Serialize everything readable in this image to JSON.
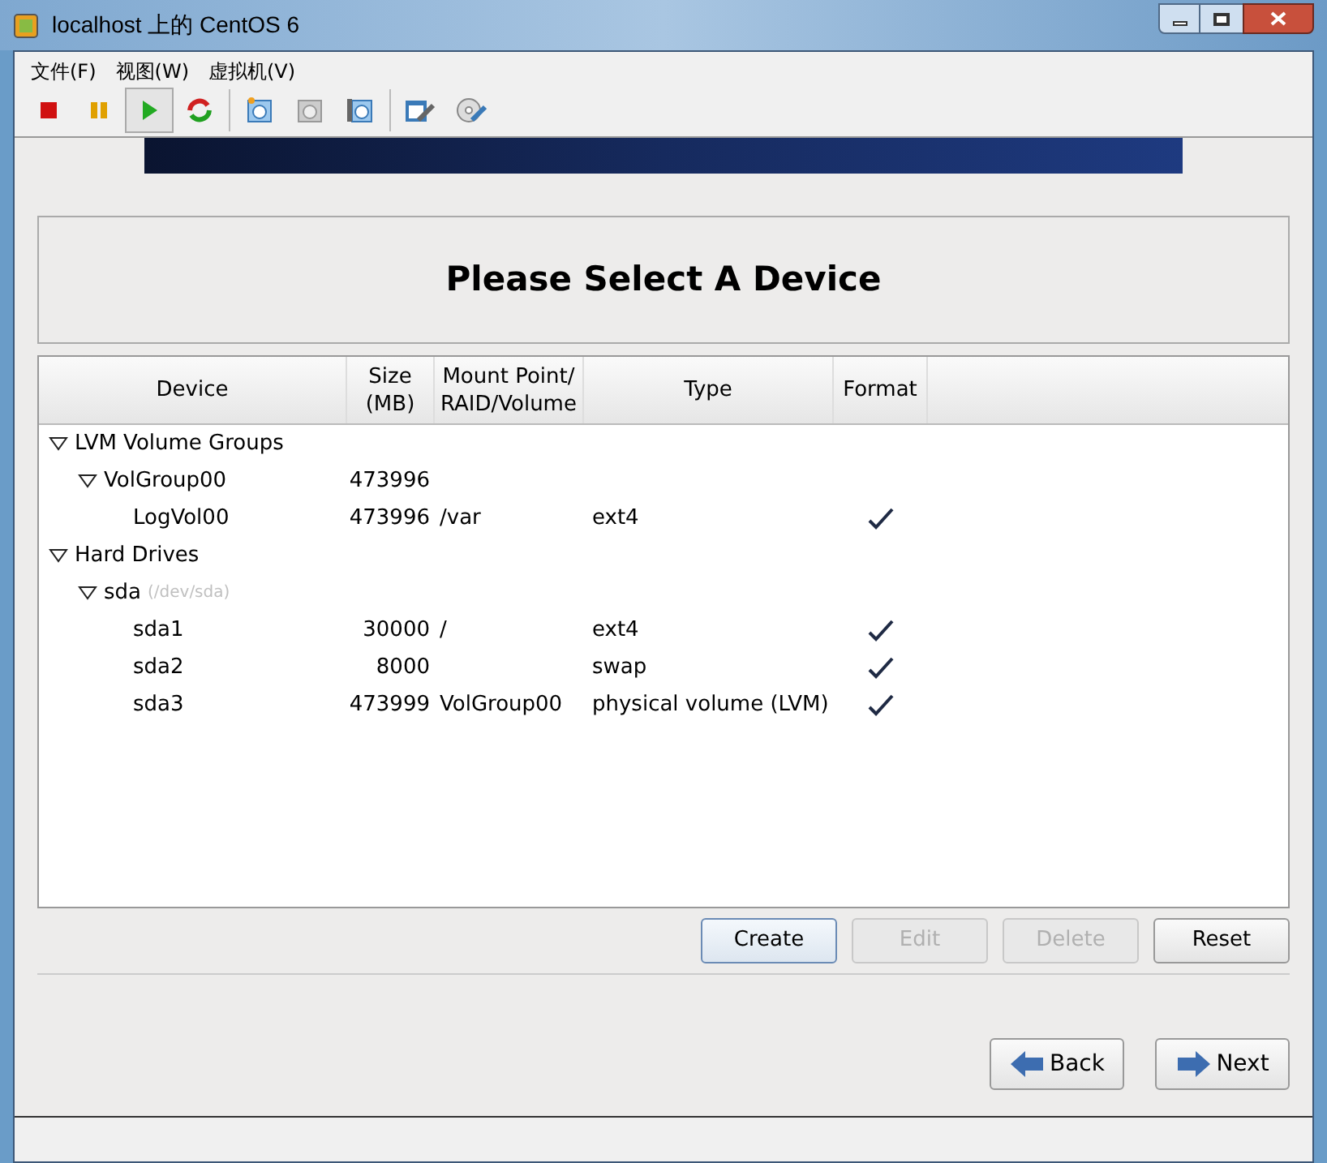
{
  "window": {
    "title": "localhost 上的 CentOS 6"
  },
  "menu": [
    "文件(F)",
    "视图(W)",
    "虚拟机(V)"
  ],
  "toolbar": [
    {
      "kind": "stop",
      "selected": false
    },
    {
      "kind": "pause",
      "selected": false
    },
    {
      "kind": "play",
      "selected": true
    },
    {
      "kind": "reset",
      "selected": false
    },
    {
      "kind": "sep"
    },
    {
      "kind": "snapshot",
      "selected": false
    },
    {
      "kind": "revert",
      "selected": false
    },
    {
      "kind": "manager",
      "selected": false
    },
    {
      "kind": "sep"
    },
    {
      "kind": "edit",
      "selected": false
    },
    {
      "kind": "cd",
      "selected": false
    }
  ],
  "heading": "Please Select A Device",
  "table": {
    "columns": [
      "Device",
      "Size\n(MB)",
      "Mount Point/\nRAID/Volume",
      "Type",
      "Format"
    ],
    "rows": [
      {
        "device": "LVM Volume Groups",
        "expanded": true,
        "children": [
          {
            "device": "VolGroup00",
            "size": "473996",
            "expanded": true,
            "children": [
              {
                "device": "LogVol00",
                "size": "473996",
                "mount": "/var",
                "type": "ext4",
                "format": true
              }
            ]
          }
        ]
      },
      {
        "device": "Hard Drives",
        "expanded": true,
        "children": [
          {
            "device": "sda",
            "note": "(/dev/sda)",
            "expanded": true,
            "children": [
              {
                "device": "sda1",
                "size": "30000",
                "mount": "/",
                "type": "ext4",
                "format": true
              },
              {
                "device": "sda2",
                "size": "8000",
                "type": "swap",
                "format": true
              },
              {
                "device": "sda3",
                "size": "473999",
                "mount": "VolGroup00",
                "type": "physical volume (LVM)",
                "format": true
              }
            ]
          }
        ]
      }
    ]
  },
  "actions": [
    {
      "label": "Create",
      "disabled": false,
      "focused": true
    },
    {
      "label": "Edit",
      "disabled": true,
      "focused": false
    },
    {
      "label": "Delete",
      "disabled": true,
      "focused": false
    },
    {
      "label": "Reset",
      "disabled": false,
      "focused": false
    }
  ],
  "nav": [
    {
      "label": "Back",
      "kind": "back"
    },
    {
      "label": "Next",
      "kind": "next"
    }
  ]
}
